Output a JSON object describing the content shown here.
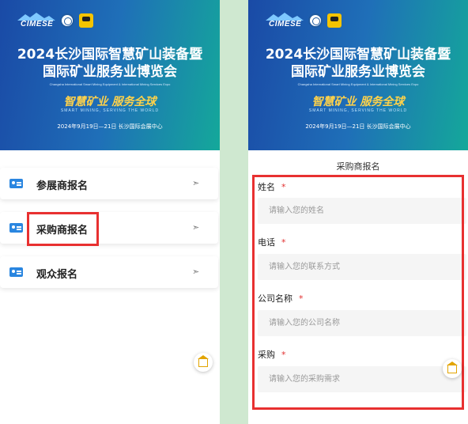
{
  "banner": {
    "logo_text": "CIMESE",
    "title_line1": "2024长沙国际智慧矿山装备暨",
    "title_line2": "国际矿业服务业博览会",
    "title_en": "Changsha International Smart Mining Equipment & International Mining Services Expo",
    "slogan": "智慧矿业 服务全球",
    "slogan_en": "SMART MINING, SERVING THE WORLD",
    "date_venue": "2024年9月19日—21日    长沙国际会展中心"
  },
  "left_menu": {
    "items": [
      {
        "label": "参展商报名",
        "icon": "id-card-icon"
      },
      {
        "label": "采购商报名",
        "icon": "id-card-icon"
      },
      {
        "label": "观众报名",
        "icon": "id-card-icon"
      }
    ],
    "arrow_glyph": "➣"
  },
  "form": {
    "title": "采购商报名",
    "required_mark": "*",
    "fields": [
      {
        "label": "姓名",
        "placeholder": "请输入您的姓名"
      },
      {
        "label": "电话",
        "placeholder": "请输入您的联系方式"
      },
      {
        "label": "公司名称",
        "placeholder": "请输入您的公司名称"
      },
      {
        "label": "采购",
        "placeholder": "请输入您的采购需求"
      }
    ]
  },
  "colors": {
    "highlight": "#e83030",
    "accent_blue": "#2a86e0",
    "required": "#e23030",
    "home_icon": "#e2a400"
  }
}
